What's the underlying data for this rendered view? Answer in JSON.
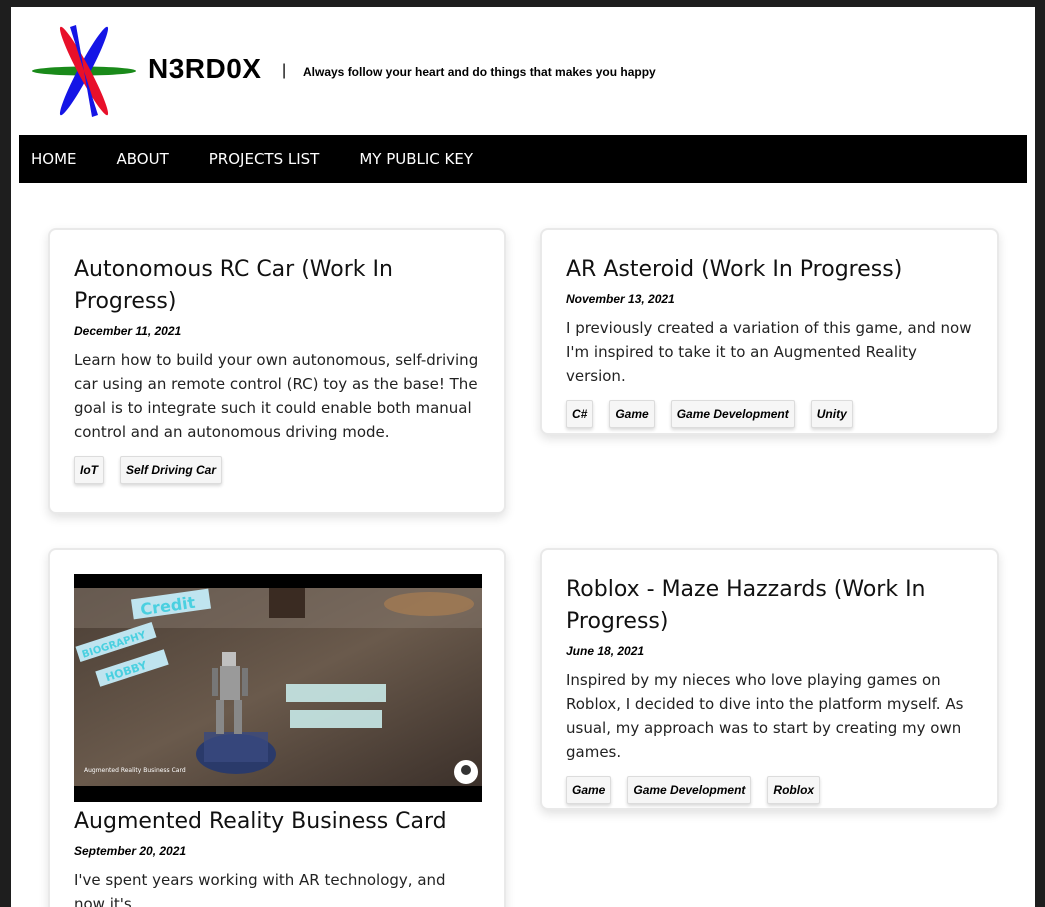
{
  "site": {
    "title": "N3RD0X",
    "separator": "|",
    "tagline": "Always follow your heart and do things that makes you happy"
  },
  "nav": {
    "items": [
      "HOME",
      "ABOUT",
      "PROJECTS LIST",
      "MY PUBLIC KEY"
    ]
  },
  "posts": [
    {
      "title": "Autonomous RC Car (Work In Progress)",
      "date": "December 11, 2021",
      "description": "Learn how to build your own autonomous, self-driving car using an remote control (RC) toy as the base! The goal is to integrate such it could enable both manual control and an autonomous driving mode.",
      "tags": [
        "IoT",
        "Self Driving Car"
      ]
    },
    {
      "title": "AR Asteroid (Work In Progress)",
      "date": "November 13, 2021",
      "description": "I previously created a variation of this game, and now I'm inspired to take it to an Augmented Reality version.",
      "tags": [
        "C#",
        "Game",
        "Game Development",
        "Unity"
      ]
    },
    {
      "title": "Augmented Reality Business Card",
      "date": "September 20, 2021",
      "description": "I've spent years working with AR technology, and now it's",
      "thumbnail_caption": "Augmented Reality Business Card",
      "thumbnail_labels": [
        "Credit",
        "BIOGRAPHY",
        "HOBBY"
      ],
      "tags": []
    },
    {
      "title": "Roblox - Maze Hazzards (Work In Progress)",
      "date": "June 18, 2021",
      "description": "Inspired by my nieces who love playing games on Roblox, I decided to dive into the platform myself. As usual, my approach was to start by creating my own games.",
      "tags": [
        "Game",
        "Game Development",
        "Roblox"
      ]
    }
  ],
  "colors": {
    "nav_bg": "#000000",
    "logo_red": "#e8102a",
    "logo_green": "#1a8a1a",
    "logo_blue": "#1515e6"
  }
}
